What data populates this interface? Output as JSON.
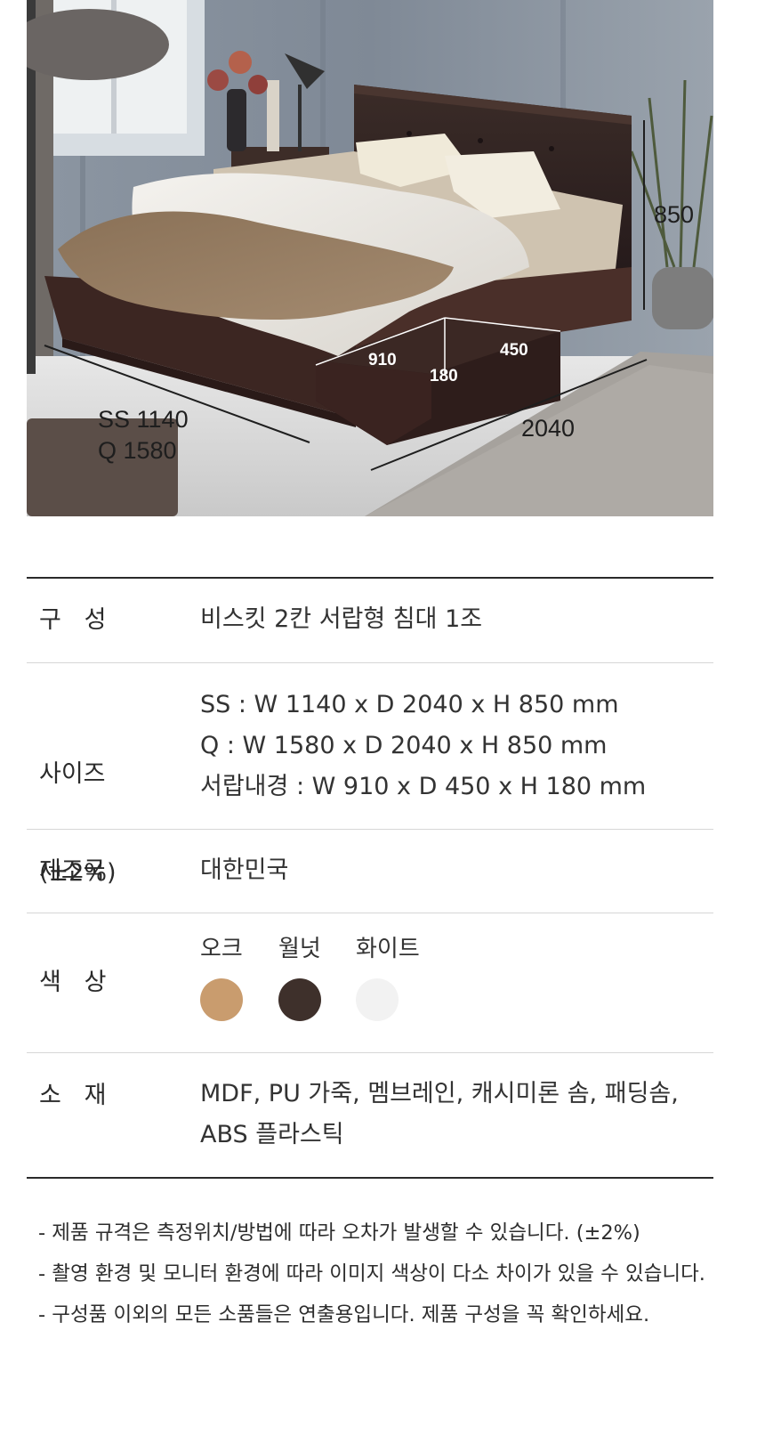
{
  "photo": {
    "dims": {
      "height": "850",
      "drawer_width": "910",
      "drawer_depth": "450",
      "drawer_height": "180",
      "length": "2040",
      "width_ss": "SS 1140",
      "width_q": "Q 1580"
    }
  },
  "spec": {
    "composition": {
      "label": "구   성",
      "value": "비스킷 2칸 서랍형 침대 1조"
    },
    "size": {
      "label_line1": "사이즈",
      "label_line2": "(±2%)",
      "lines": [
        "SS : W 1140 x D 2040 x H 850 mm",
        "Q : W 1580 x D 2040 x H 850 mm",
        "서랍내경 : W 910 x D 450 x H 180 mm"
      ]
    },
    "origin": {
      "label": "제조국",
      "value": "대한민국"
    },
    "color": {
      "label": "색   상",
      "options": [
        {
          "name": "오크",
          "hex": "#C99C6E"
        },
        {
          "name": "월넛",
          "hex": "#3E302B"
        },
        {
          "name": "화이트",
          "hex": "#F2F2F2"
        }
      ]
    },
    "material": {
      "label": "소   재",
      "lines": [
        "MDF, PU 가죽, 멤브레인, 캐시미론 솜, 패딩솜,",
        "ABS 플라스틱"
      ]
    }
  },
  "notes": [
    "- 제품 규격은 측정위치/방법에 따라 오차가 발생할 수 있습니다. (±2%)",
    "- 촬영 환경 및 모니터 환경에 따라 이미지 색상이 다소 차이가 있을 수 있습니다.",
    "- 구성품 이외의 모든 소품들은 연출용입니다. 제품 구성을 꼭 확인하세요."
  ]
}
